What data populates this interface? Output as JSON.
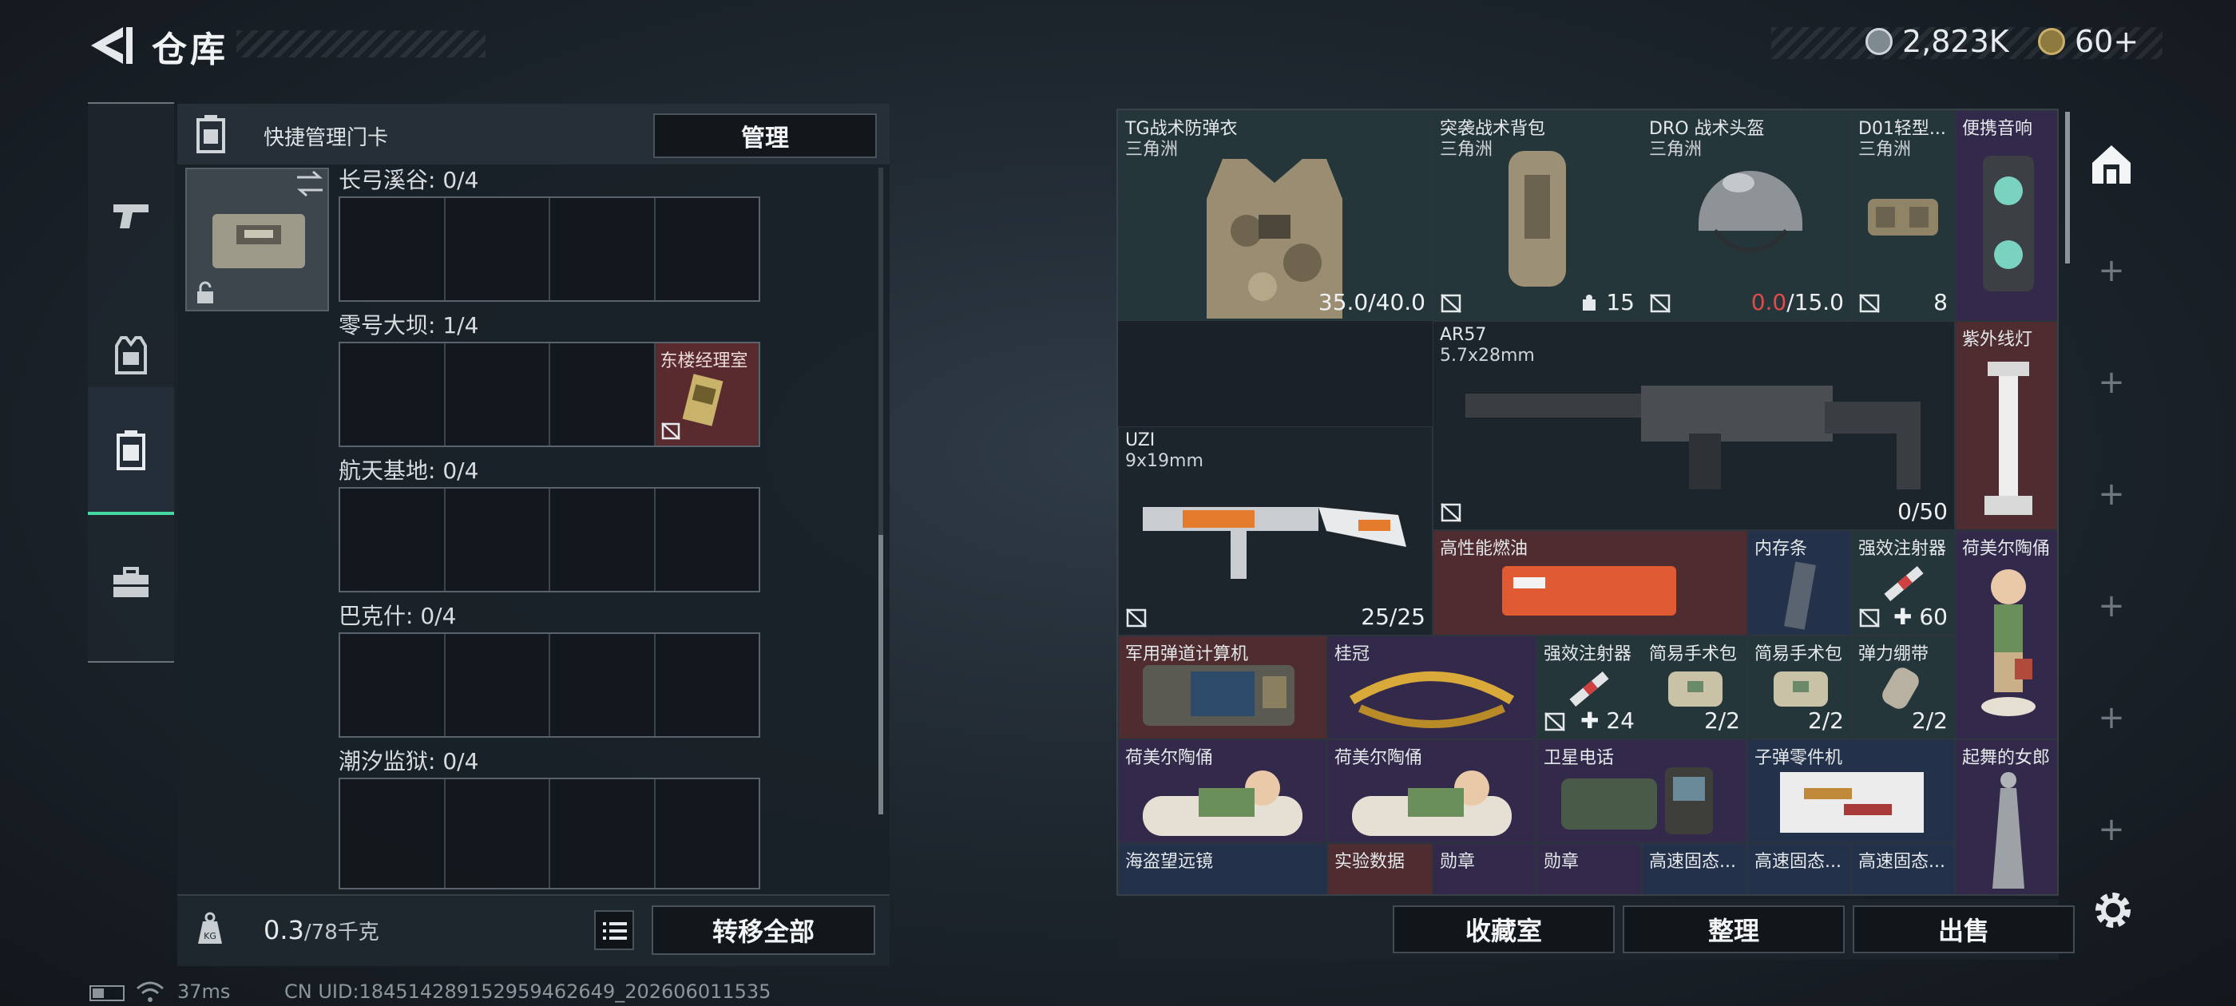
{
  "header": {
    "title": "仓库",
    "currency": [
      {
        "icon": "silver-coin-icon",
        "value": "2,823K"
      },
      {
        "icon": "gold-coin-icon",
        "value": "60+"
      }
    ]
  },
  "nav": {
    "items": [
      {
        "name": "weapons-tab",
        "icon": "pistol-icon",
        "active": false
      },
      {
        "name": "equipment-tab",
        "icon": "vest-icon",
        "active": false
      },
      {
        "name": "keycard-tab",
        "icon": "keycard-icon",
        "active": true
      },
      {
        "name": "supplies-tab",
        "icon": "toolbox-icon",
        "active": false
      }
    ]
  },
  "left_panel": {
    "header_label": "快捷管理门卡",
    "manage_label": "管理",
    "maps": [
      {
        "label": "长弓溪谷: 0/4",
        "slots": [
          "",
          "",
          "",
          ""
        ]
      },
      {
        "label": "零号大坝: 1/4",
        "slots": [
          "",
          "",
          "",
          "东楼经理室"
        ]
      },
      {
        "label": "航天基地: 0/4",
        "slots": [
          "",
          "",
          "",
          ""
        ]
      },
      {
        "label": "巴克什: 0/4",
        "slots": [
          "",
          "",
          "",
          ""
        ]
      },
      {
        "label": "潮汐监狱: 0/4",
        "slots": [
          "",
          "",
          "",
          ""
        ]
      }
    ],
    "weight": "0.3",
    "weight_unit": "/78千克",
    "transfer_label": "转移全部"
  },
  "inventory": {
    "items": [
      {
        "name": "TG战术防弹衣",
        "sub": "三角洲",
        "value": "35.0/40.0",
        "rarity": "green"
      },
      {
        "name": "突袭战术背包",
        "sub": "三角洲",
        "value": "15",
        "rarity": "green"
      },
      {
        "name": "DRO 战术头盔",
        "sub": "三角洲",
        "value_red": "0.0",
        "value": "/15.0",
        "rarity": "green"
      },
      {
        "name": "D01轻型...",
        "sub": "三角洲",
        "value": "8",
        "rarity": "green"
      },
      {
        "name": "便携音响",
        "sub": "",
        "value": "",
        "rarity": "purple"
      },
      {
        "name": "AR57",
        "sub": "5.7x28mm",
        "value": "0/50",
        "rarity": "dark"
      },
      {
        "name": "紫外线灯",
        "sub": "",
        "value": "",
        "rarity": "red"
      },
      {
        "name": "UZI",
        "sub": "9x19mm",
        "value": "25/25",
        "rarity": "dark"
      },
      {
        "name": "高性能燃油",
        "sub": "",
        "value": "",
        "rarity": "red"
      },
      {
        "name": "内存条",
        "sub": "",
        "value": "",
        "rarity": "blue"
      },
      {
        "name": "强效注射器",
        "sub": "",
        "value": "60",
        "rarity": "green"
      },
      {
        "name": "荷美尔陶俑",
        "sub": "",
        "value": "",
        "rarity": "purple"
      },
      {
        "name": "军用弹道计算机",
        "sub": "",
        "value": "",
        "rarity": "red"
      },
      {
        "name": "桂冠",
        "sub": "",
        "value": "",
        "rarity": "purple"
      },
      {
        "name": "强效注射器",
        "sub": "",
        "value": "24",
        "rarity": "green"
      },
      {
        "name": "简易手术包",
        "sub": "",
        "value": "2/2",
        "rarity": "green"
      },
      {
        "name": "简易手术包",
        "sub": "",
        "value": "2/2",
        "rarity": "green"
      },
      {
        "name": "弹力绷带",
        "sub": "",
        "value": "2/2",
        "rarity": "green"
      },
      {
        "name": "荷美尔陶俑",
        "sub": "",
        "value": "",
        "rarity": "purple"
      },
      {
        "name": "荷美尔陶俑",
        "sub": "",
        "value": "",
        "rarity": "purple"
      },
      {
        "name": "卫星电话",
        "sub": "",
        "value": "",
        "rarity": "purple"
      },
      {
        "name": "子弹零件机",
        "sub": "",
        "value": "",
        "rarity": "blue"
      },
      {
        "name": "起舞的女郎",
        "sub": "",
        "value": "",
        "rarity": "purple"
      },
      {
        "name": "海盗望远镜",
        "sub": "",
        "value": "",
        "rarity": "blue"
      },
      {
        "name": "实验数据",
        "sub": "",
        "value": "",
        "rarity": "red"
      },
      {
        "name": "勋章",
        "sub": "",
        "value": "",
        "rarity": "purple"
      },
      {
        "name": "勋章",
        "sub": "",
        "value": "",
        "rarity": "purple"
      },
      {
        "name": "高速固态...",
        "sub": "",
        "value": "",
        "rarity": "blue"
      },
      {
        "name": "高速固态...",
        "sub": "",
        "value": "",
        "rarity": "blue"
      },
      {
        "name": "高速固态...",
        "sub": "",
        "value": "",
        "rarity": "blue"
      }
    ]
  },
  "bottom_buttons": {
    "collection": "收藏室",
    "sort": "整理",
    "sell": "出售"
  },
  "status_bar": {
    "ping": "37ms",
    "uid": "CN UID:1845142891529594626​49_202606011535"
  },
  "colors": {
    "accent": "#44d8a2",
    "rarity_green": "#25363a",
    "rarity_blue": "#23324a",
    "rarity_purple": "#33294a",
    "rarity_red": "#4e2c2f",
    "warning_red": "#e04a4a"
  }
}
